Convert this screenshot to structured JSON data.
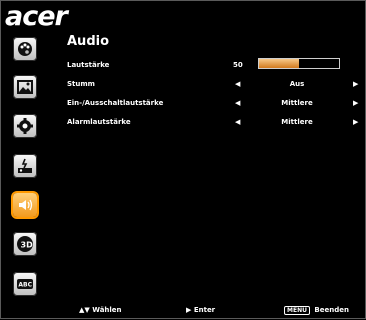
{
  "brand": "acer",
  "title": "Audio",
  "sidebar": {
    "tabs": [
      {
        "id": "color",
        "icon": "palette-icon",
        "active": false
      },
      {
        "id": "image",
        "icon": "picture-icon",
        "active": false
      },
      {
        "id": "settings",
        "icon": "gear-icon",
        "active": false
      },
      {
        "id": "management",
        "icon": "projector-power-icon",
        "active": false
      },
      {
        "id": "audio",
        "icon": "speaker-icon",
        "active": true
      },
      {
        "id": "3d",
        "icon": "3d-icon",
        "active": false
      },
      {
        "id": "language",
        "icon": "abc-icon",
        "active": false
      }
    ]
  },
  "rows": [
    {
      "label": "Lautstärke",
      "type": "slider",
      "value_text": "50",
      "value": 50
    },
    {
      "label": "Stumm",
      "type": "select",
      "value": "Aus"
    },
    {
      "label": "Ein-/Ausschaltlautstärke",
      "type": "select",
      "value": "Mittlere"
    },
    {
      "label": "Alarmlautstärke",
      "type": "select",
      "value": "Mittlere"
    }
  ],
  "footer": {
    "select_symbol": "▲▼",
    "select_label": "Wählen",
    "enter_symbol": "▶",
    "enter_label": "Enter",
    "menu_key": "MENU",
    "exit_label": "Beenden"
  },
  "colors": {
    "accent": "#ff9900",
    "fill": "#d27a1e"
  }
}
